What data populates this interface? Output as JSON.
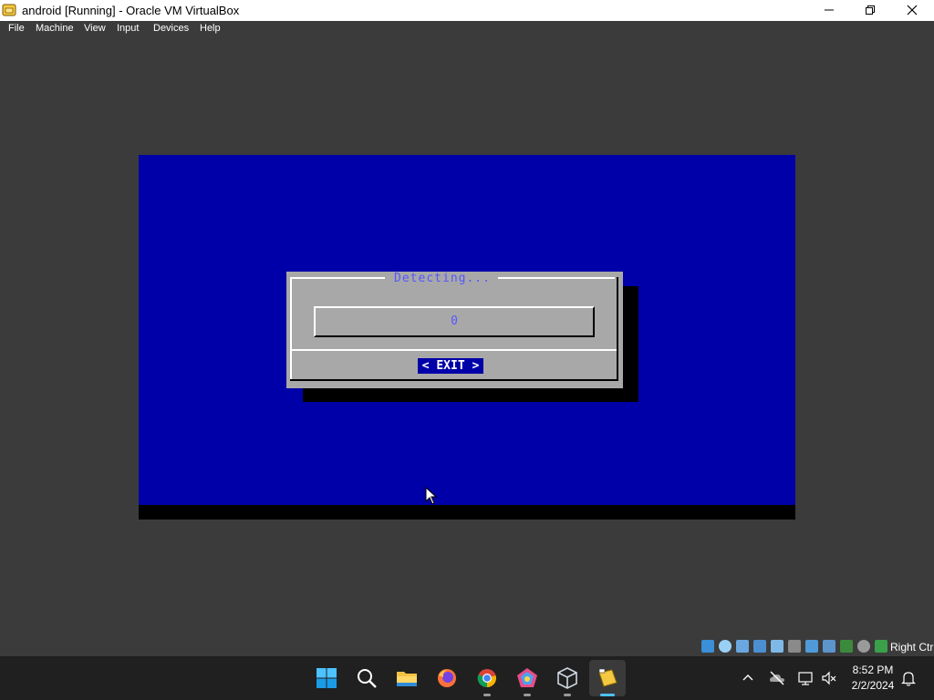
{
  "window": {
    "title": "android [Running] - Oracle VM VirtualBox"
  },
  "menu": {
    "items": [
      "File",
      "Machine",
      "View",
      "Input",
      "Devices",
      "Help"
    ]
  },
  "vm": {
    "dialog": {
      "title": "Detecting...",
      "gauge_value": "0",
      "exit_label": "< EXIT >"
    }
  },
  "statusbar": {
    "host_key": "Right Ctrl",
    "icons": [
      "hard-disk-icon",
      "optical-drive-icon",
      "audio-icon",
      "network-icon",
      "usb-icon",
      "shared-folders-icon",
      "display-icon",
      "recording-icon",
      "cpu-icon",
      "mouse-integration-icon",
      "keyboard-icon"
    ]
  },
  "taskbar": {
    "apps": [
      "windows-start-icon",
      "search-icon",
      "file-explorer-icon",
      "firefox-icon",
      "chrome-icon",
      "app-icon",
      "virtualbox-manager-icon",
      "virtualbox-vm-icon"
    ],
    "clock": {
      "time": "8:52 PM",
      "date": "2/2/2024"
    }
  },
  "colors": {
    "vm_background": "#0000a8",
    "dialog_background": "#a8a8a8",
    "dialog_text": "#5656ff",
    "taskbar": "#202020"
  }
}
